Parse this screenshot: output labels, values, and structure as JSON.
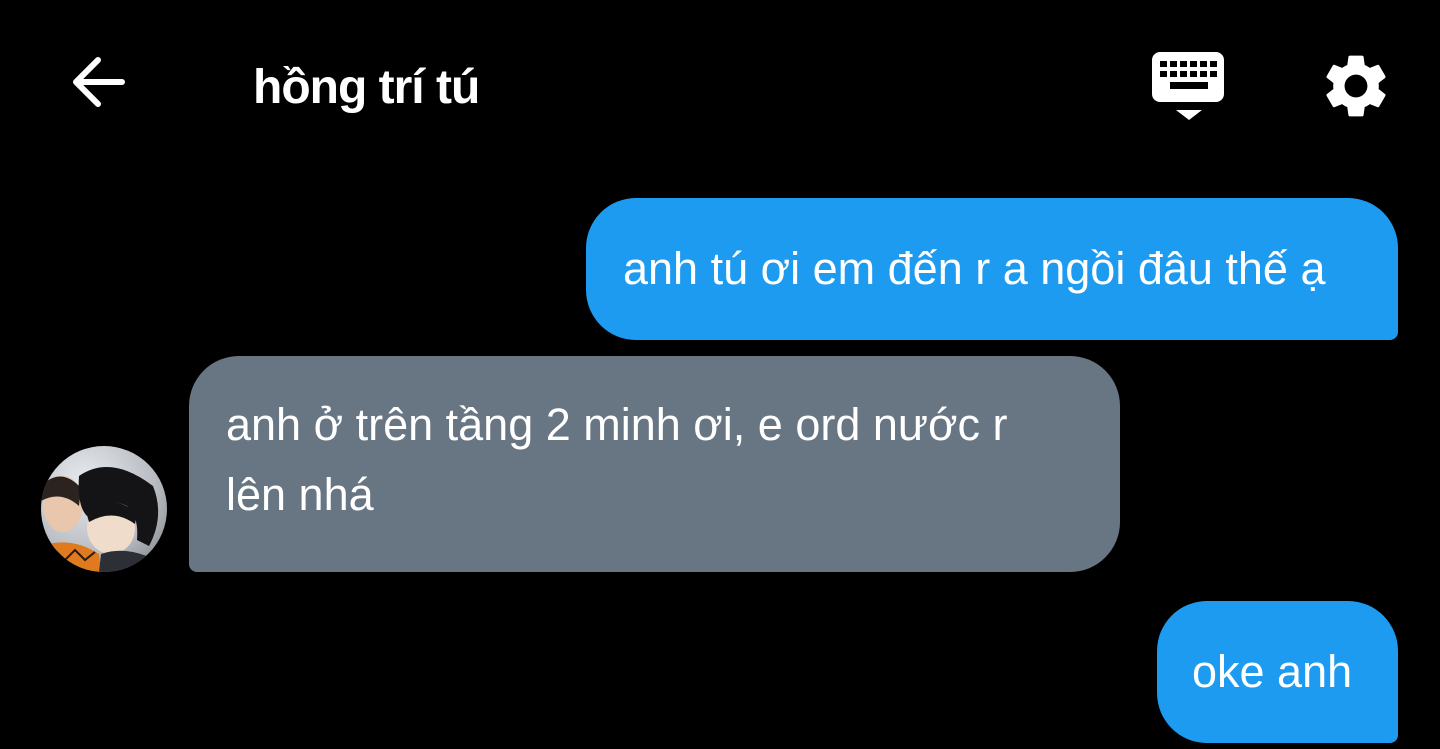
{
  "header": {
    "title": "hồng trí tú",
    "back_icon": "arrow-left-icon",
    "keyboard_icon": "keyboard-hide-icon",
    "settings_icon": "gear-icon"
  },
  "colors": {
    "background": "#000000",
    "outgoing_bubble": "#1d9bf0",
    "incoming_bubble": "#687684",
    "text": "#ffffff"
  },
  "messages": [
    {
      "sender": "outgoing",
      "text": "anh tú ơi em đến r a ngồi đâu thế ạ"
    },
    {
      "sender": "incoming",
      "text": "anh ở trên tầng 2 minh ơi, e ord nước r lên nhá"
    },
    {
      "sender": "outgoing",
      "text": "oke anh"
    }
  ]
}
